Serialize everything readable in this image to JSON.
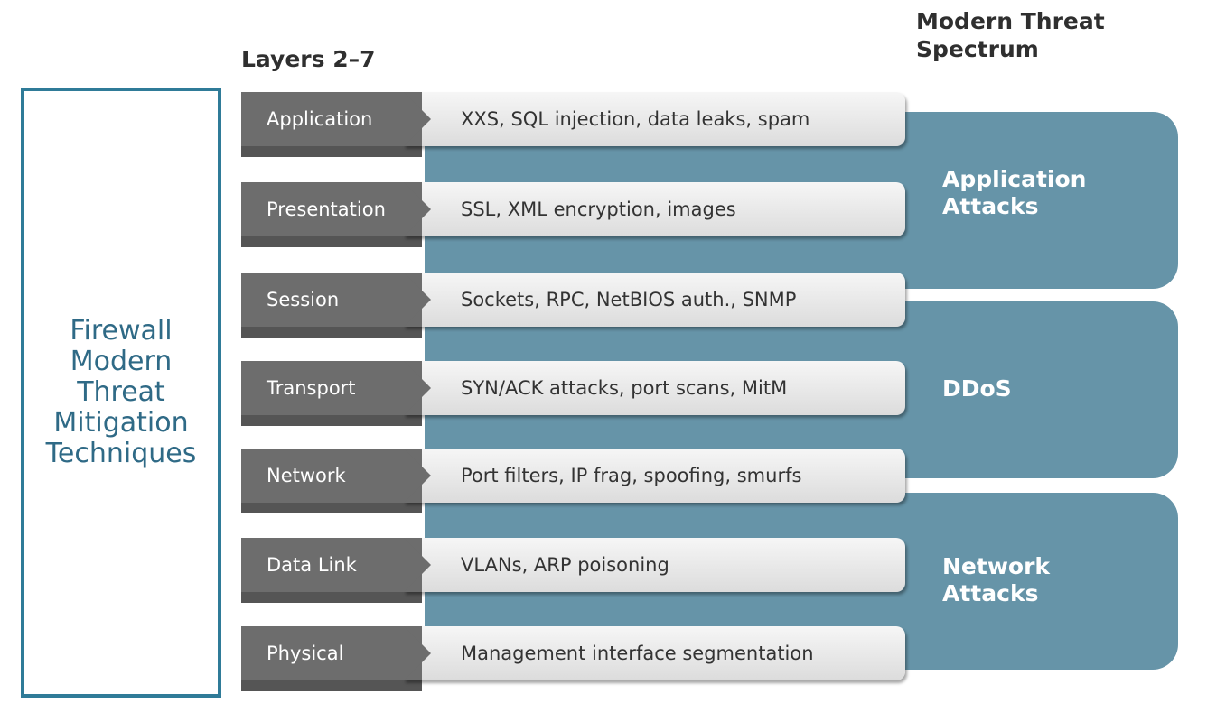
{
  "headings": {
    "layers": "Layers 2–7",
    "spectrum": "Modern Threat\nSpectrum"
  },
  "left_panel": {
    "text": "Firewall\nModern\nThreat\nMitigation\nTechniques"
  },
  "layers": [
    {
      "name": "Application",
      "threats": "XXS, SQL injection, data leaks, spam"
    },
    {
      "name": "Presentation",
      "threats": "SSL, XML encryption, images"
    },
    {
      "name": "Session",
      "threats": "Sockets, RPC, NetBIOS auth., SNMP"
    },
    {
      "name": "Transport",
      "threats": "SYN/ACK attacks, port scans, MitM"
    },
    {
      "name": "Network",
      "threats": "Port filters, IP frag, spoofing, smurfs"
    },
    {
      "name": "Data Link",
      "threats": "VLANs, ARP poisoning"
    },
    {
      "name": "Physical",
      "threats": "Management interface segmentation"
    }
  ],
  "threat_groups": [
    {
      "label": "Application\nAttacks",
      "covers": [
        "Application",
        "Presentation"
      ]
    },
    {
      "label": "DDoS",
      "covers": [
        "Session",
        "Transport",
        "Network"
      ]
    },
    {
      "label": "Network\nAttacks",
      "covers": [
        "Data Link",
        "Physical"
      ]
    }
  ],
  "colors": {
    "accent": "#2f7b98",
    "band": "#6694a8",
    "layer_box": "#6d6d6d"
  }
}
